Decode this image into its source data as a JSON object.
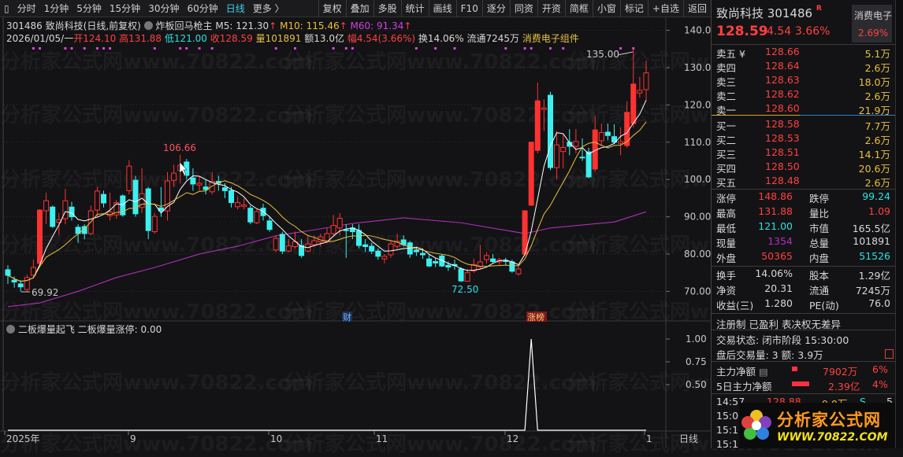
{
  "toolbar": {
    "periods": [
      "分时",
      "1分钟",
      "5分钟",
      "15分钟",
      "30分钟",
      "60分钟",
      "日线",
      "更多 〉"
    ],
    "active_period": "日线",
    "actions": [
      "复权",
      "叠加",
      "多股",
      "统计",
      "画线",
      "F10",
      "逐分",
      "同资",
      "开资",
      "简框",
      "小窗",
      "标记",
      "+自选",
      "返回"
    ]
  },
  "header": {
    "code": "301486",
    "name": "致尚科技",
    "mode": "(日线,前复权)",
    "indicator": "炸板回马枪主",
    "ma5_label": "M5:",
    "ma5": "121.30",
    "ma10_label": "M10:",
    "ma10": "115.46",
    "ma60_label": "M60:",
    "ma60": "91.34",
    "date": "2026/01/05/一",
    "open_label": "开",
    "open": "124.10",
    "high_label": "高",
    "high": "131.88",
    "low_label": "低",
    "low": "121.00",
    "close_label": "收",
    "close": "128.59",
    "vol_label": "量",
    "vol": "101891",
    "amt_label": "额",
    "amt": "13.0亿",
    "chg_label": "幅",
    "chg": "4.54(3.66%)",
    "turn_label": "换",
    "turn": "14.06%",
    "float_label": "流通",
    "float": "7245万",
    "sector": "消费电子组件"
  },
  "colors": {
    "up": "#ff3232",
    "down": "#3cf0f0",
    "ma5": "#ffffff",
    "ma10": "#e8c040",
    "ma60": "#c030d0",
    "signal": "#e040e0",
    "background": "#131315"
  },
  "chart_data": {
    "type": "candlestick",
    "price_axis": {
      "ticks": [
        "140.0",
        "130.0",
        "120.0",
        "110.0",
        "100.0",
        "90.00",
        "80.00",
        "70.00"
      ],
      "range": [
        67,
        141
      ]
    },
    "x_ticks": [
      "2025年",
      "9",
      "10",
      "11",
      "12",
      "1"
    ],
    "period_label": "日线",
    "annotations": {
      "high_1": "106.66",
      "low_1": "69.92",
      "low_2": "72.50",
      "high_2": "135.00"
    },
    "event_markers": [
      "财",
      "涨榜"
    ],
    "ohlc": [
      [
        75.8,
        77,
        72,
        74.3
      ],
      [
        73,
        74,
        71,
        72.5
      ],
      [
        72,
        73,
        69.92,
        71.2
      ],
      [
        70.5,
        74.5,
        70,
        73.7
      ],
      [
        74.3,
        78.5,
        73.5,
        76.4
      ],
      [
        77.5,
        92,
        77,
        91.8
      ],
      [
        91.6,
        96.5,
        88,
        94.3
      ],
      [
        92.6,
        93,
        87,
        87.4
      ],
      [
        88.5,
        91,
        85,
        89.2
      ],
      [
        89.5,
        97.5,
        88,
        94.3
      ],
      [
        92.6,
        94,
        89,
        90
      ],
      [
        87.2,
        88,
        83,
        85.5
      ],
      [
        87.4,
        88,
        84,
        85.5
      ],
      [
        85.5,
        93,
        85,
        91.6
      ],
      [
        91.8,
        98,
        90,
        96.9
      ],
      [
        96,
        97,
        92.5,
        93.7
      ],
      [
        90.3,
        96.5,
        89,
        91.3
      ],
      [
        90.5,
        94.5,
        89.5,
        93.8
      ],
      [
        95.6,
        96,
        90,
        90.5
      ],
      [
        97,
        105.2,
        96,
        103.6
      ],
      [
        99.8,
        101,
        90,
        90.8
      ],
      [
        92.5,
        103,
        91,
        96.2
      ],
      [
        97.5,
        98,
        84,
        86.3
      ],
      [
        86,
        91,
        85.5,
        90.1
      ],
      [
        92.4,
        98,
        90,
        91.6
      ],
      [
        91.6,
        102,
        89,
        99.6
      ],
      [
        99.8,
        104,
        98,
        101.7
      ],
      [
        102.4,
        106.66,
        99,
        103.8
      ],
      [
        104.7,
        105.5,
        100,
        101.1
      ],
      [
        100.4,
        103,
        97,
        98.8
      ],
      [
        98.5,
        101,
        97,
        99
      ],
      [
        98,
        100,
        96,
        97.3
      ],
      [
        96.7,
        102,
        96,
        99.5
      ],
      [
        99.5,
        101,
        97,
        99
      ],
      [
        97.8,
        99,
        95,
        97
      ],
      [
        97,
        98,
        92.5,
        93.8
      ],
      [
        92.7,
        95.5,
        92,
        93.8
      ],
      [
        92.8,
        95,
        92,
        93.2
      ],
      [
        92.3,
        93,
        88,
        88.6
      ],
      [
        88.4,
        92,
        88,
        91.4
      ],
      [
        92.3,
        93.5,
        89,
        90.3
      ],
      [
        88.9,
        90,
        86,
        86.6
      ],
      [
        81.1,
        85,
        80.5,
        84.2
      ],
      [
        85.3,
        86,
        80,
        80.8
      ],
      [
        80.8,
        84,
        80.5,
        82.2
      ],
      [
        82,
        86,
        81.5,
        83.3
      ],
      [
        82.3,
        84,
        79,
        79.6
      ],
      [
        80.8,
        85,
        80.5,
        82.7
      ],
      [
        82.5,
        85,
        82,
        83.6
      ],
      [
        83.3,
        85.5,
        82,
        84.6
      ],
      [
        83.6,
        87,
        83,
        85.5
      ],
      [
        85.5,
        90.5,
        85,
        87.7
      ],
      [
        87,
        91,
        85,
        89.6
      ],
      [
        86.5,
        88,
        79,
        86.3
      ],
      [
        87,
        88,
        84,
        86
      ],
      [
        86.3,
        88,
        81.5,
        82.3
      ],
      [
        82.5,
        84,
        80.5,
        82
      ],
      [
        82.1,
        83,
        80,
        80.8
      ],
      [
        80.8,
        81.5,
        78.5,
        79.4
      ],
      [
        78.7,
        80,
        77.5,
        79.4
      ],
      [
        79.8,
        83.5,
        79,
        82.7
      ],
      [
        82.1,
        85.5,
        81.5,
        83.4
      ],
      [
        83.8,
        85,
        82,
        82.5
      ],
      [
        83,
        83.5,
        79,
        80
      ],
      [
        81,
        82,
        79.5,
        80.6
      ],
      [
        80.2,
        81.5,
        78.7,
        79.8
      ],
      [
        78.7,
        80,
        76.5,
        76.8
      ],
      [
        78,
        79,
        76.5,
        77.6
      ],
      [
        79.5,
        80,
        76.5,
        76.8
      ],
      [
        77,
        78,
        75.5,
        76.5
      ],
      [
        77.2,
        78.5,
        75.8,
        76.9
      ],
      [
        76,
        76.5,
        72.5,
        72.8
      ],
      [
        72.7,
        76,
        72.6,
        75
      ],
      [
        75.5,
        78.8,
        75,
        77.2
      ],
      [
        76.6,
        82.5,
        76,
        77.9
      ],
      [
        78.5,
        80.5,
        77.5,
        79.6
      ],
      [
        78.7,
        80,
        77.5,
        78
      ],
      [
        77.9,
        79,
        77,
        78.4
      ],
      [
        78.3,
        79,
        77,
        78
      ],
      [
        77.9,
        78.5,
        75,
        75.4
      ],
      [
        74.7,
        77.2,
        74.2,
        76
      ],
      [
        80,
        91.8,
        79.5,
        91.6
      ],
      [
        93.1,
        110.2,
        93,
        110
      ],
      [
        107.8,
        126,
        107,
        121.1
      ],
      [
        118.8,
        121.5,
        113,
        119.2
      ],
      [
        122.6,
        123.5,
        102.5,
        103.2
      ],
      [
        103.2,
        113,
        100,
        109.3
      ],
      [
        107.5,
        112,
        103,
        108.6
      ],
      [
        110,
        113.5,
        106.5,
        108.9
      ],
      [
        108.9,
        113.5,
        107,
        110.2
      ],
      [
        106,
        111,
        105,
        105.8
      ],
      [
        107.4,
        108.5,
        100.3,
        100.7
      ],
      [
        102.8,
        117,
        102,
        113.3
      ],
      [
        110.4,
        115,
        109,
        112.6
      ],
      [
        112.7,
        115,
        110.5,
        111.8
      ],
      [
        111.5,
        114.8,
        109.5,
        110
      ],
      [
        109.7,
        114,
        106.5,
        110.2
      ],
      [
        109.1,
        121,
        108.5,
        118
      ],
      [
        115,
        135,
        114,
        125.6
      ],
      [
        123.2,
        127.5,
        122,
        123.9
      ],
      [
        124.1,
        131.88,
        121,
        128.59
      ]
    ],
    "ma60_points": [
      [
        0,
        65.9
      ],
      [
        5,
        66.9
      ],
      [
        11,
        70
      ],
      [
        17,
        73.7
      ],
      [
        23,
        76.4
      ],
      [
        30,
        80
      ],
      [
        36,
        82.1
      ],
      [
        42,
        84.9
      ],
      [
        48,
        86.5
      ],
      [
        54,
        88.2
      ],
      [
        62,
        89.7
      ],
      [
        71,
        88.4
      ],
      [
        81,
        85.5
      ],
      [
        85,
        87
      ],
      [
        95,
        88.6
      ],
      [
        100,
        91.34
      ]
    ],
    "signal_markers": [
      4,
      5,
      9,
      10,
      12,
      14,
      15,
      16,
      23,
      27,
      28,
      30,
      32,
      42,
      45,
      51,
      53,
      54,
      64,
      67,
      70,
      78,
      81,
      82,
      85,
      87,
      96,
      98
    ],
    "sub_indicator": {
      "title": "二板爆量起飞",
      "series_label": "二板爆量涨停:",
      "current": "0.00",
      "ticks": [
        "1.00",
        "0.75",
        "0.50"
      ],
      "range": [
        0,
        1
      ],
      "spike_index": 82
    }
  },
  "quote": {
    "name": "致尚科技",
    "code": "301486",
    "badge": "R",
    "price": "128.59",
    "change": "4.54",
    "pct": "3.66%",
    "sector": "消费电子",
    "sector_pct": "2.69%",
    "asks": [
      [
        "卖五 ¥",
        "128.66",
        "5.1万"
      ],
      [
        "卖四",
        "128.64",
        "2.6万"
      ],
      [
        "卖三",
        "128.63",
        "18.0万"
      ],
      [
        "卖二",
        "128.62",
        "2.6万"
      ],
      [
        "卖一",
        "128.60",
        "21.9万"
      ]
    ],
    "bids": [
      [
        "买一",
        "128.58",
        "7.7万"
      ],
      [
        "买二",
        "128.53",
        "2.6万"
      ],
      [
        "买三",
        "128.51",
        "14.1万"
      ],
      [
        "买四",
        "128.50",
        "20.6万"
      ],
      [
        "买五",
        "128.48",
        "2.6万"
      ]
    ],
    "stats": [
      [
        "涨停",
        "148.86",
        "跌停",
        "99.24"
      ],
      [
        "最高",
        "131.88",
        "量比",
        "1.09"
      ],
      [
        "最低",
        "121.00",
        "市值",
        "165.5亿"
      ],
      [
        "现量",
        "1354",
        "总量",
        "101891"
      ],
      [
        "外盘",
        "50365",
        "内盘",
        "51526"
      ]
    ],
    "fundamentals": [
      [
        "换手",
        "14.06%",
        "股本",
        "1.29亿"
      ],
      [
        "净资",
        "20.31",
        "流通",
        "7245万"
      ],
      [
        "收益(三)",
        "1.280",
        "PE(动)",
        "76.0"
      ]
    ],
    "tags": "注册制 已盈利 表决权无差异",
    "trade_status": "交易状态: 闭市阶段 15:30:00",
    "after_hours": "盘后交易量: 3  额: 3.9万",
    "main_flow": {
      "label": "主力净额",
      "value": "7902万",
      "pct": "6%",
      "bar": 0.1
    },
    "main_flow_5d": {
      "label": "5日主力净额",
      "value": "2.39亿",
      "pct": "4%",
      "bar": 0.3
    },
    "ticks": [
      [
        "14:57",
        "128.88",
        "9.0万",
        "S",
        "5"
      ],
      [
        "15:0"
      ],
      [
        "15:1"
      ],
      [
        "15:1"
      ]
    ]
  },
  "logo": {
    "text": "分析家公式网",
    "url_text": "WWW.70822.COM"
  },
  "watermark": "分析家公式网www.70822.com"
}
